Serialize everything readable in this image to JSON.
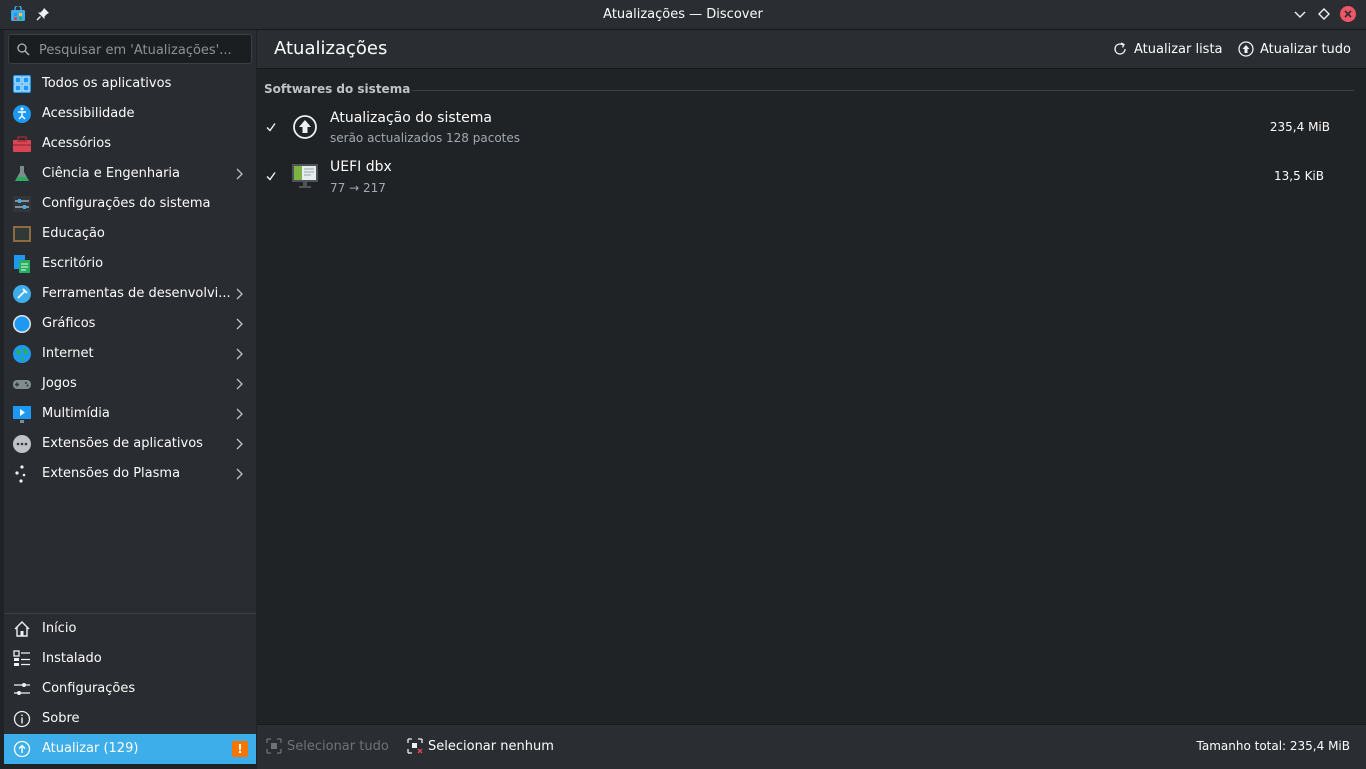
{
  "window": {
    "title": "Atualizações — Discover"
  },
  "search": {
    "placeholder": "Pesquisar em 'Atualizações'..."
  },
  "categories": [
    {
      "label": "Todos os aplicativos",
      "icon": "grid-icon",
      "has_children": false
    },
    {
      "label": "Acessibilidade",
      "icon": "accessibility-icon",
      "has_children": false
    },
    {
      "label": "Acessórios",
      "icon": "toolbox-icon",
      "has_children": false
    },
    {
      "label": "Ciência e Engenharia",
      "icon": "flask-icon",
      "has_children": true
    },
    {
      "label": "Configurações do sistema",
      "icon": "system-settings-icon",
      "has_children": false
    },
    {
      "label": "Educação",
      "icon": "chalkboard-icon",
      "has_children": false
    },
    {
      "label": "Escritório",
      "icon": "office-icon",
      "has_children": false
    },
    {
      "label": "Ferramentas de desenvolvi...",
      "icon": "dev-tools-icon",
      "has_children": true
    },
    {
      "label": "Gráficos",
      "icon": "graphics-icon",
      "has_children": true
    },
    {
      "label": "Internet",
      "icon": "globe-icon",
      "has_children": true
    },
    {
      "label": "Jogos",
      "icon": "gamepad-icon",
      "has_children": true
    },
    {
      "label": "Multimídia",
      "icon": "multimedia-icon",
      "has_children": true
    },
    {
      "label": "Extensões de aplicativos",
      "icon": "more-icon",
      "has_children": true
    },
    {
      "label": "Extensões do Plasma",
      "icon": "plasma-icon",
      "has_children": true
    }
  ],
  "bottom_nav": {
    "home": "Início",
    "installed": "Instalado",
    "settings": "Configurações",
    "about": "Sobre",
    "update": "Atualizar (129)"
  },
  "header": {
    "title": "Atualizações",
    "refresh_label": "Atualizar lista",
    "update_all_label": "Atualizar tudo"
  },
  "section": {
    "title": "Softwares do sistema"
  },
  "updates": [
    {
      "name": "Atualização do sistema",
      "subtitle": "serão actualizados 128 pacotes",
      "size": "235,4 MiB",
      "checked": true,
      "icon": "system-update-icon"
    },
    {
      "name": "UEFI dbx",
      "subtitle": "77 → 217",
      "size": "13,5 KiB",
      "checked": true,
      "icon": "computer-icon"
    }
  ],
  "footer": {
    "select_all": "Selecionar tudo",
    "select_none": "Selecionar nenhum",
    "total": "Tamanho total: 235,4 MiB"
  },
  "colors": {
    "accent": "#3daee9",
    "background": "#202326",
    "warning": "#f67400"
  }
}
